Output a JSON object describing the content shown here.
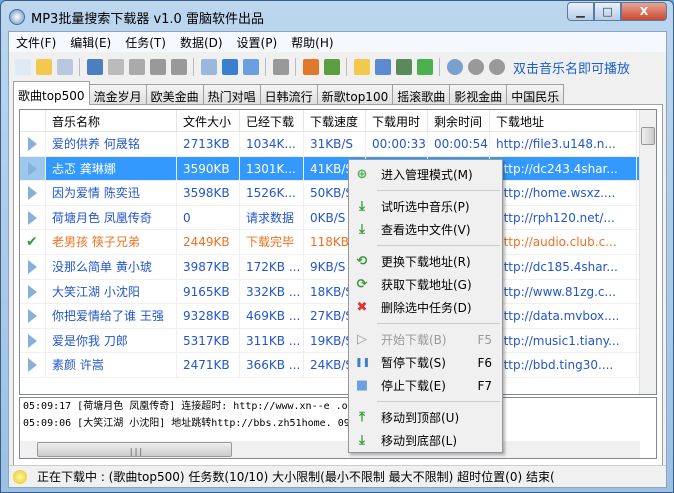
{
  "window": {
    "title": "MP3批量搜索下载器 v1.0 雷脑软件出品",
    "minimize": "▁",
    "maximize": "□",
    "close": "X"
  },
  "menu": [
    "文件(F)",
    "编辑(E)",
    "任务(T)",
    "数据(D)",
    "设置(P)",
    "帮助(H)"
  ],
  "toolbar": {
    "hint": "双击音乐名即可播放",
    "icons": [
      "new-file",
      "open-folder",
      "grid",
      "save",
      "copy",
      "paste",
      "undo",
      "redo",
      "play",
      "pause",
      "stop",
      "gear",
      "home",
      "users",
      "folder",
      "help",
      "collapse",
      "expand",
      "play-circle",
      "pause-circle",
      "stop-circle"
    ]
  },
  "tabs": [
    "歌曲top500",
    "流金岁月",
    "欧美金曲",
    "热门对唱",
    "日韩流行",
    "新歌top100",
    "摇滚歌曲",
    "影视金曲",
    "中国民乐"
  ],
  "table": {
    "headers": [
      "音乐名称",
      "文件大小",
      "已经下载",
      "下载速度",
      "下载用时",
      "剩余时间",
      "下载地址"
    ],
    "rows": [
      {
        "status": "play",
        "name": "爱的供养 何晟铭",
        "size": "2713KB",
        "done": "1034K...",
        "speed": "31KB/S",
        "elapsed": "00:00:33",
        "remain": "00:00:54",
        "url": "http://file3.u148.n..."
      },
      {
        "status": "play",
        "name": "忐忑 龚琳娜",
        "size": "3590KB",
        "done": "1301K...",
        "speed": "41KB/S",
        "elapsed": "",
        "remain": "",
        "url": "http://dc243.4shar...",
        "selected": true
      },
      {
        "status": "play",
        "name": "因为爱情 陈奕迅",
        "size": "3598KB",
        "done": "1526K...",
        "speed": "50KB/S",
        "elapsed": "",
        "remain": "",
        "url": "http://home.wsxz...."
      },
      {
        "status": "play",
        "name": "荷塘月色 凤凰传奇",
        "size": "0",
        "done": "请求数据",
        "speed": "0KB/S",
        "elapsed": "",
        "remain": "",
        "url": "http://rph120.net/..."
      },
      {
        "status": "done",
        "name": "老男孩 筷子兄弟",
        "size": "2449KB",
        "done": "下载完毕",
        "speed": "118KB/S",
        "elapsed": "",
        "remain": "",
        "url": "http://audio.club.c..."
      },
      {
        "status": "play",
        "name": "没那么简单 黄小琥",
        "size": "3987KB",
        "done": "172KB ...",
        "speed": "9KB/S",
        "elapsed": "",
        "remain": "",
        "url": "http://dc185.4shar..."
      },
      {
        "status": "play",
        "name": "大笑江湖 小沈阳",
        "size": "9165KB",
        "done": "332KB ...",
        "speed": "18KB/S",
        "elapsed": "",
        "remain": "",
        "url": "http://www.81zg.c..."
      },
      {
        "status": "play",
        "name": "你把爱情给了谁 王强",
        "size": "9328KB",
        "done": "469KB ...",
        "speed": "27KB/S",
        "elapsed": "",
        "remain": "",
        "url": "http://data.mvbox...."
      },
      {
        "status": "play",
        "name": "爱是你我 刀郎",
        "size": "5317KB",
        "done": "311KB ...",
        "speed": "19KB/S",
        "elapsed": "",
        "remain": "",
        "url": "http://music1.tiany..."
      },
      {
        "status": "play",
        "name": "素颜 许嵩",
        "size": "2471KB",
        "done": "366KB ...",
        "speed": "24KB/S",
        "elapsed": "",
        "remain": "",
        "url": "http://bbd.ting30...."
      }
    ]
  },
  "log": [
    "05:09:17 [荷塘月色 凤凰传奇] 连接超时: http://www.xn--e                                        .oadfile/files/20112141",
    "05:09:06 [大笑江湖 小沈阳] 地址跳转http://bbs.zh51home.                                  09/14381787815559.mp3"
  ],
  "status": "正在下载中 : (歌曲top500) 任务数(10/10) 大小限制(最小不限制 最大不限制) 超时位置(0) 结束(",
  "context_menu": [
    {
      "label": "进入管理模式(M)",
      "icon": "plus-circle",
      "color": "#4caf50"
    },
    {
      "sep": true
    },
    {
      "label": "试听选中音乐(P)",
      "icon": "download-arrow",
      "color": "#3a9a3a"
    },
    {
      "label": "查看选中文件(V)",
      "icon": "download-arrow",
      "color": "#3a9a3a"
    },
    {
      "sep": true
    },
    {
      "label": "更换下载地址(R)",
      "icon": "replace",
      "color": "#3a9a3a"
    },
    {
      "label": "获取下载地址(G)",
      "icon": "refresh",
      "color": "#3a9a3a"
    },
    {
      "label": "删除选中任务(D)",
      "icon": "delete-x",
      "color": "#e03030"
    },
    {
      "sep": true
    },
    {
      "label": "开始下载(B)",
      "key": "F5",
      "icon": "play",
      "color": "#999",
      "disabled": true
    },
    {
      "label": "暂停下载(S)",
      "key": "F6",
      "icon": "pause",
      "color": "#3b7fd0"
    },
    {
      "label": "停止下载(E)",
      "key": "F7",
      "icon": "stop",
      "color": "#6aa0e0"
    },
    {
      "sep": true
    },
    {
      "label": "移动到顶部(U)",
      "icon": "move-top",
      "color": "#3a9a3a"
    },
    {
      "label": "移动到底部(L)",
      "icon": "move-bottom",
      "color": "#3a9a3a"
    }
  ]
}
